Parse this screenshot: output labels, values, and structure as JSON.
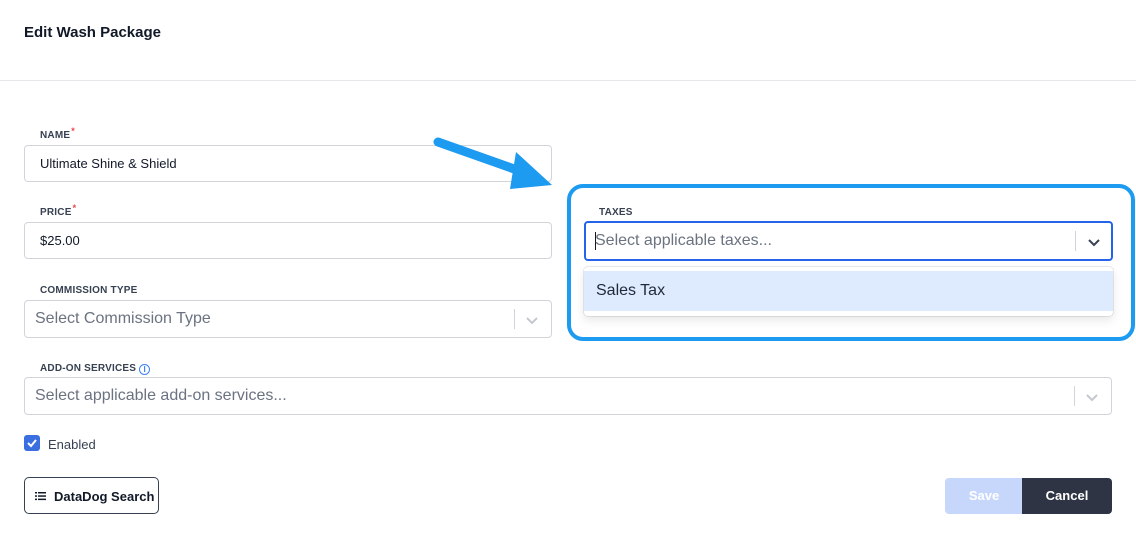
{
  "dialog": {
    "title": "Edit Wash Package"
  },
  "fields": {
    "name": {
      "label": "NAME",
      "required_mark": "*",
      "value": "Ultimate Shine & Shield"
    },
    "price": {
      "label": "PRICE",
      "required_mark": "*",
      "value": "$25.00"
    },
    "commission_type": {
      "label": "COMMISSION TYPE",
      "placeholder": "Select Commission Type"
    },
    "taxes": {
      "label": "TAXES",
      "placeholder": "Select applicable taxes...",
      "options": [
        "Sales Tax"
      ]
    },
    "add_on_services": {
      "label": "ADD-ON SERVICES",
      "info_icon": "i",
      "placeholder": "Select applicable add-on services..."
    }
  },
  "enabled": {
    "label": "Enabled",
    "checked": true
  },
  "buttons": {
    "datadog": "DataDog Search",
    "save": "Save",
    "cancel": "Cancel"
  },
  "colors": {
    "annotation_blue": "#1d9bf0",
    "focus_blue": "#2563eb",
    "option_highlight": "#deebff",
    "save_disabled": "#c7d7fb",
    "cancel_dark": "#2f3445"
  }
}
